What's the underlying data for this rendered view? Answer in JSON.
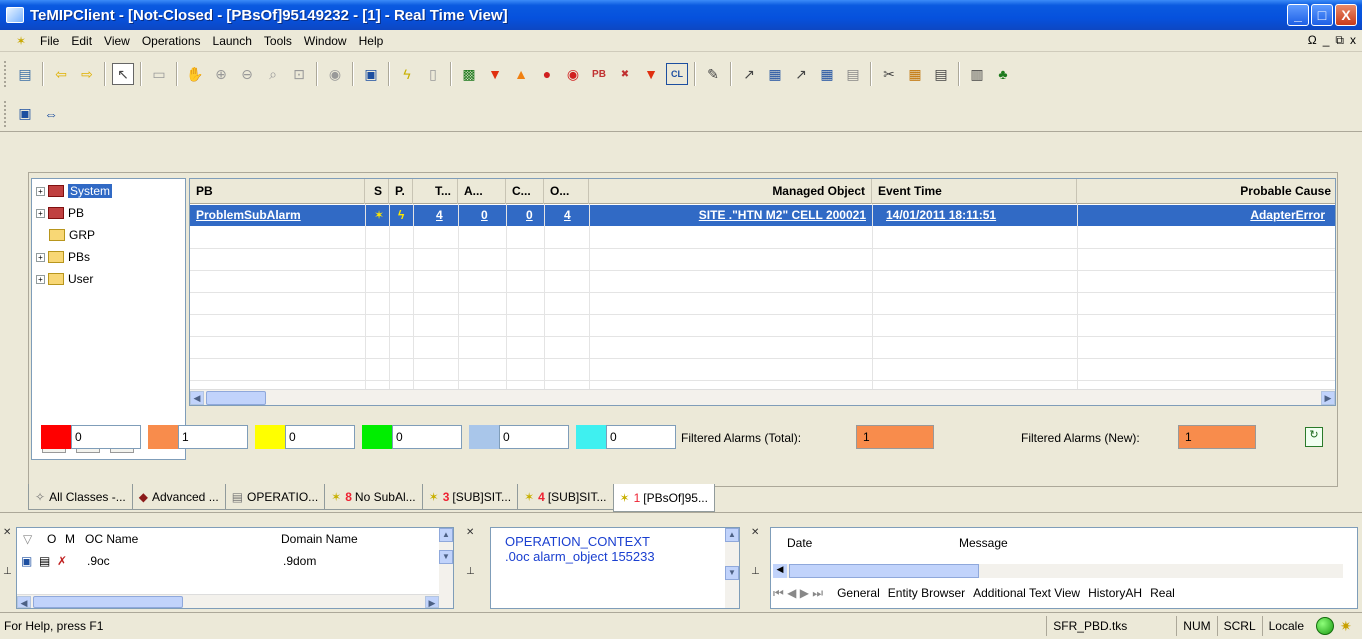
{
  "window": {
    "title": "TeMIPClient - [Not-Closed - [PBsOf]95149232 - [1] - Real Time View]",
    "min": "_",
    "max": "□",
    "close": "X"
  },
  "menu": [
    "File",
    "Edit",
    "View",
    "Operations",
    "Launch",
    "Tools",
    "Window",
    "Help"
  ],
  "mdi_controls": [
    "Ω",
    "_",
    "⧉",
    "x"
  ],
  "tree": {
    "nodes": [
      {
        "label": "System",
        "expand": "+",
        "selected": true
      },
      {
        "label": "PB",
        "expand": "+"
      },
      {
        "label": "GRP",
        "expand": ""
      },
      {
        "label": "PBs",
        "expand": "+"
      },
      {
        "label": "User",
        "expand": "+"
      }
    ]
  },
  "grid": {
    "columns": [
      "PB",
      "S",
      "P.",
      "T...",
      "A...",
      "C...",
      "O...",
      "Managed Object",
      "Event Time",
      "Probable Cause"
    ],
    "rows": [
      {
        "pb": "ProblemSubAlarm",
        "t": "4",
        "a": "0",
        "c": "0",
        "o": "4",
        "managed_object": "SITE .\"HTN M2\" CELL 200021",
        "event_time": "14/01/2011 18:11:51",
        "probable_cause": "AdapterError"
      }
    ]
  },
  "counters": [
    {
      "color": "#ff0000",
      "value": "0"
    },
    {
      "color": "#f88c4c",
      "value": "1"
    },
    {
      "color": "#ffff00",
      "value": "0"
    },
    {
      "color": "#00ee00",
      "value": "0"
    },
    {
      "color": "#a9c6ea",
      "value": "0"
    },
    {
      "color": "#3ff0f0",
      "value": "0"
    }
  ],
  "filtered": {
    "total_label": "Filtered Alarms (Total):",
    "total_value": "1",
    "new_label": "Filtered Alarms (New):",
    "new_value": "1"
  },
  "tabs": [
    {
      "label": "All Classes -..."
    },
    {
      "label": "Advanced ..."
    },
    {
      "label": "OPERATIO..."
    },
    {
      "num": "8",
      "label": "No SubAl..."
    },
    {
      "num": "3",
      "label": "[SUB]SIT..."
    },
    {
      "num": "4",
      "label": "[SUB]SIT..."
    },
    {
      "num": "1",
      "label": "[PBsOf]95..."
    }
  ],
  "oc_panel": {
    "columns": [
      "O",
      "M",
      "OC Name",
      "Domain Name"
    ],
    "row": {
      "oc_name": ".9oc",
      "domain_name": ".9dom"
    }
  },
  "context_panel": {
    "line1": "OPERATION_CONTEXT",
    "line2": ".0oc alarm_object 155233"
  },
  "log_panel": {
    "columns": [
      "Date",
      "Message"
    ],
    "tabs": [
      "General",
      "Entity Browser",
      "Additional Text View",
      "HistoryAH",
      "Real"
    ]
  },
  "status": {
    "help": "For Help, press F1",
    "file": "SFR_PBD.tks",
    "num": "NUM",
    "scrl": "SCRL",
    "locale": "Locale"
  }
}
